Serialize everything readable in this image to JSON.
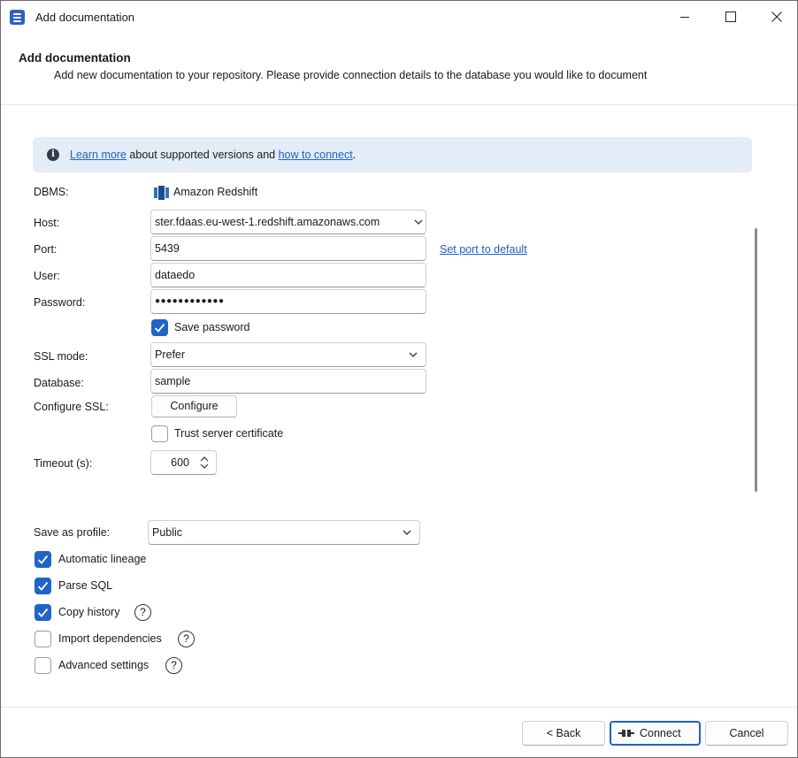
{
  "window": {
    "title": "Add documentation"
  },
  "header": {
    "title": "Add documentation",
    "description": "Add new documentation to your repository. Please provide connection details to the database you would like to document"
  },
  "info": {
    "link1": "Learn more",
    "text1": " about supported versions and ",
    "link2": "how to connect",
    "text2": "."
  },
  "form": {
    "dbms_label": "DBMS:",
    "dbms_value": "Amazon Redshift",
    "host_label": "Host:",
    "host_value": "ster.fdaas.eu-west-1.redshift.amazonaws.com",
    "port_label": "Port:",
    "port_value": "5439",
    "port_default_link": "Set port to default",
    "user_label": "User:",
    "user_value": "dataedo",
    "password_label": "Password:",
    "password_value": "●●●●●●●●●●●●",
    "save_password_label": "Save password",
    "save_password_checked": true,
    "ssl_mode_label": "SSL mode:",
    "ssl_mode_value": "Prefer",
    "database_label": "Database:",
    "database_value": "sample",
    "configure_ssl_label": "Configure SSL:",
    "configure_button": "Configure",
    "trust_cert_label": "Trust server certificate",
    "trust_cert_checked": false,
    "timeout_label": "Timeout (s):",
    "timeout_value": "600"
  },
  "options": {
    "profile_label": "Save as profile:",
    "profile_value": "Public",
    "automatic_lineage": "Automatic lineage",
    "automatic_lineage_checked": true,
    "parse_sql": "Parse SQL",
    "parse_sql_checked": true,
    "copy_history": "Copy history",
    "copy_history_checked": true,
    "import_dependencies": "Import dependencies",
    "import_dependencies_checked": false,
    "advanced_settings": "Advanced settings",
    "advanced_settings_checked": false,
    "help_glyph": "?"
  },
  "footer": {
    "back": "< Back",
    "connect": "Connect",
    "cancel": "Cancel"
  },
  "colors": {
    "accent": "#2063c9",
    "info_bg": "#e3ecf7",
    "link": "#1f62c9"
  }
}
